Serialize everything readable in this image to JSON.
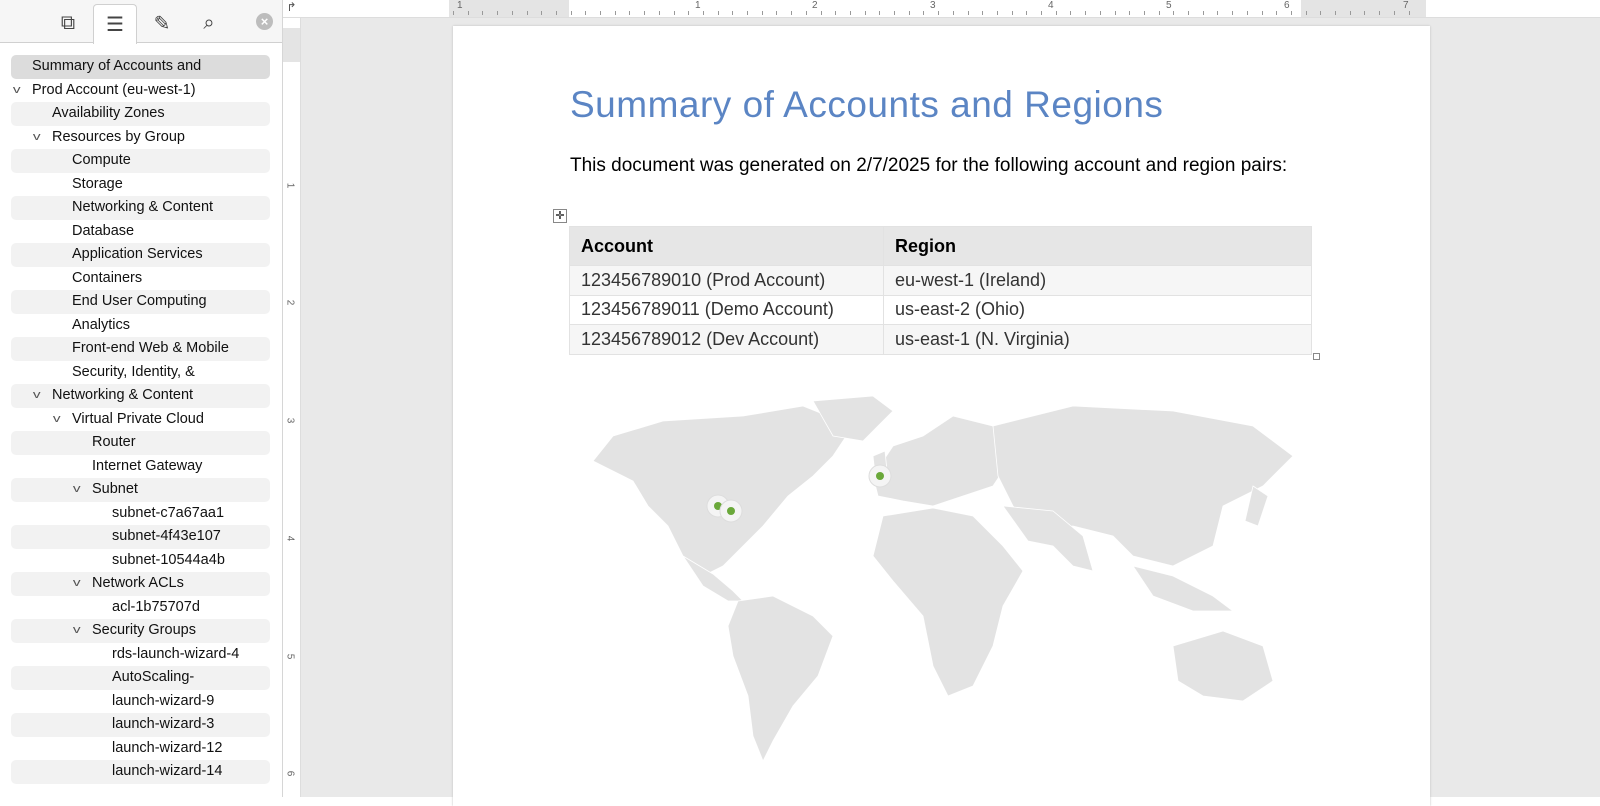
{
  "sidebar": {
    "tabs": [
      {
        "icon": "pages-icon"
      },
      {
        "icon": "outline-icon",
        "active": true
      },
      {
        "icon": "edit-document-icon"
      },
      {
        "icon": "search-icon"
      }
    ],
    "items": [
      {
        "label": "Summary of Accounts and",
        "level": 0,
        "selected": true
      },
      {
        "label": "Prod Account (eu-west-1)",
        "level": 0,
        "expanded": true
      },
      {
        "label": "Availability Zones",
        "level": 1
      },
      {
        "label": "Resources by Group",
        "level": 1,
        "expanded": true
      },
      {
        "label": "Compute",
        "level": 2
      },
      {
        "label": "Storage",
        "level": 2
      },
      {
        "label": "Networking & Content",
        "level": 2
      },
      {
        "label": "Database",
        "level": 2
      },
      {
        "label": "Application Services",
        "level": 2
      },
      {
        "label": "Containers",
        "level": 2
      },
      {
        "label": "End User Computing",
        "level": 2
      },
      {
        "label": "Analytics",
        "level": 2
      },
      {
        "label": "Front-end Web & Mobile",
        "level": 2
      },
      {
        "label": "Security, Identity, &",
        "level": 2
      },
      {
        "label": "Networking & Content",
        "level": 1,
        "expanded": true
      },
      {
        "label": "Virtual Private Cloud",
        "level": 2,
        "expanded": true
      },
      {
        "label": "Router",
        "level": 3
      },
      {
        "label": "Internet Gateway",
        "level": 3
      },
      {
        "label": "Subnet",
        "level": 3,
        "expanded": true
      },
      {
        "label": "subnet-c7a67aa1",
        "level": 4
      },
      {
        "label": "subnet-4f43e107",
        "level": 4
      },
      {
        "label": "subnet-10544a4b",
        "level": 4
      },
      {
        "label": "Network ACLs",
        "level": 3,
        "expanded": true
      },
      {
        "label": "acl-1b75707d",
        "level": 4
      },
      {
        "label": "Security Groups",
        "level": 3,
        "expanded": true
      },
      {
        "label": "rds-launch-wizard-4",
        "level": 4
      },
      {
        "label": "AutoScaling-",
        "level": 4
      },
      {
        "label": "launch-wizard-9",
        "level": 4
      },
      {
        "label": "launch-wizard-3",
        "level": 4
      },
      {
        "label": "launch-wizard-12",
        "level": 4
      },
      {
        "label": "launch-wizard-14",
        "level": 4
      }
    ]
  },
  "ruler": {
    "h_labels": [
      "1",
      "1",
      "2",
      "3",
      "4",
      "5",
      "6",
      "7"
    ],
    "v_labels": [
      "1",
      "2",
      "3",
      "4",
      "5",
      "6"
    ]
  },
  "document": {
    "title": "Summary of Accounts and Regions",
    "intro": "This document was generated on 2/7/2025 for the following account and region pairs:",
    "table": {
      "headers": [
        "Account",
        "Region"
      ],
      "rows": [
        [
          "123456789010 (Prod Account)",
          "eu-west-1 (Ireland)"
        ],
        [
          "123456789011 (Demo Account)",
          "us-east-2 (Ohio)"
        ],
        [
          "123456789012 (Dev Account)",
          "us-east-1 (N. Virginia)"
        ]
      ]
    },
    "map": {
      "land_color": "#e3e3e3",
      "marker_color": "#6aa83a",
      "markers": [
        "eu-west-1",
        "us-east-2",
        "us-east-1"
      ]
    }
  }
}
